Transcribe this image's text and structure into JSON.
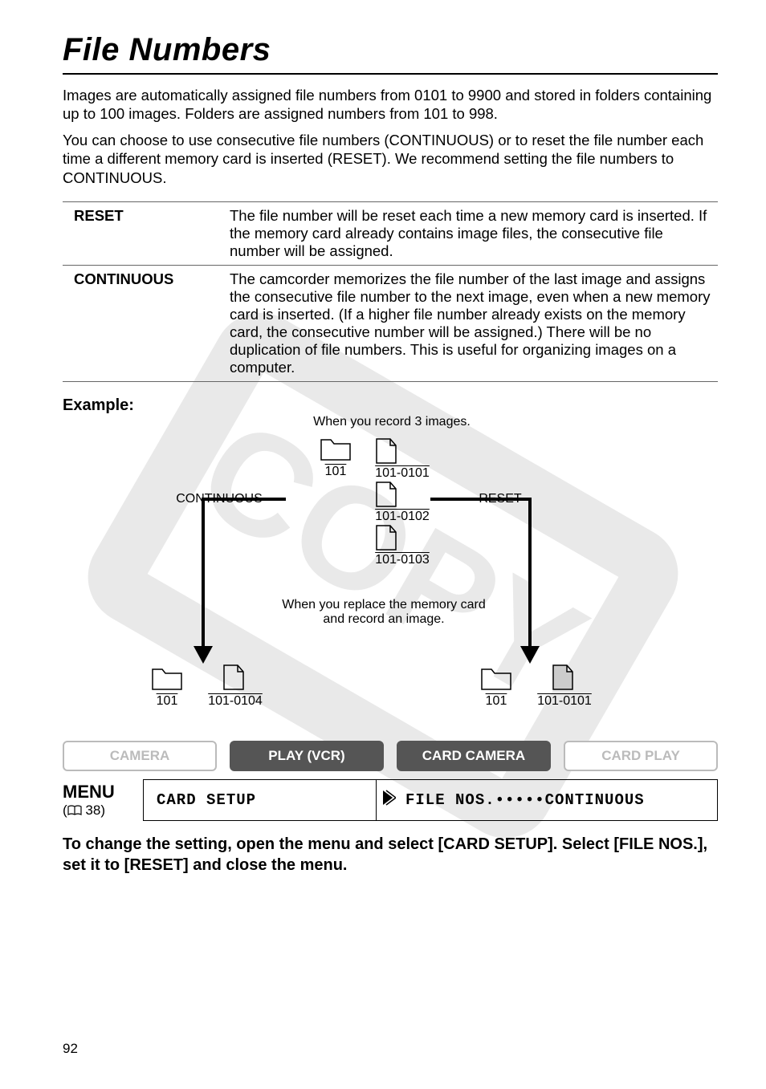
{
  "title": "File Numbers",
  "intro": {
    "p1": "Images are automatically assigned file numbers from 0101 to 9900 and stored in folders containing up to 100 images. Folders are assigned numbers from 101 to 998.",
    "p2": "You can choose to use consecutive file numbers (CONTINUOUS) or to reset the file number each time a different memory card is inserted (RESET). We recommend setting the file numbers to CONTINUOUS."
  },
  "table": {
    "rows": [
      {
        "label": "RESET",
        "desc": "The file number will be reset each time a new memory card is inserted. If the memory card already contains image files, the consecutive file number will be assigned."
      },
      {
        "label": "CONTINUOUS",
        "desc": "The camcorder memorizes the file number of the last image and assigns the consecutive file number to the next image, even when a new memory card is inserted. (If a higher file number already exists on the memory card, the consecutive number will be assigned.) There will be no duplication of file numbers. This is useful for organizing images on a computer."
      }
    ]
  },
  "example": {
    "label": "Example:",
    "caption_top": "When you record 3 images.",
    "folder_top": "101",
    "files": [
      "101-0101",
      "101-0102",
      "101-0103"
    ],
    "left_label": "CONTINUOUS",
    "right_label": "RESET",
    "caption_mid": "When you replace the memory card\nand record an image.",
    "left_folder": "101",
    "left_file": "101-0104",
    "right_folder": "101",
    "right_file": "101-0101"
  },
  "modes": [
    "CAMERA",
    "PLAY (VCR)",
    "CARD CAMERA",
    "CARD PLAY"
  ],
  "menu": {
    "heading": "MENU",
    "ref_prefix": "(",
    "ref_page": "38)",
    "left": "CARD SETUP",
    "right": "FILE NOS.•••••CONTINUOUS"
  },
  "instruction": "To change the setting, open the menu and select [CARD SETUP]. Select [FILE NOS.], set it to [RESET] and close the menu.",
  "page_number": "92"
}
